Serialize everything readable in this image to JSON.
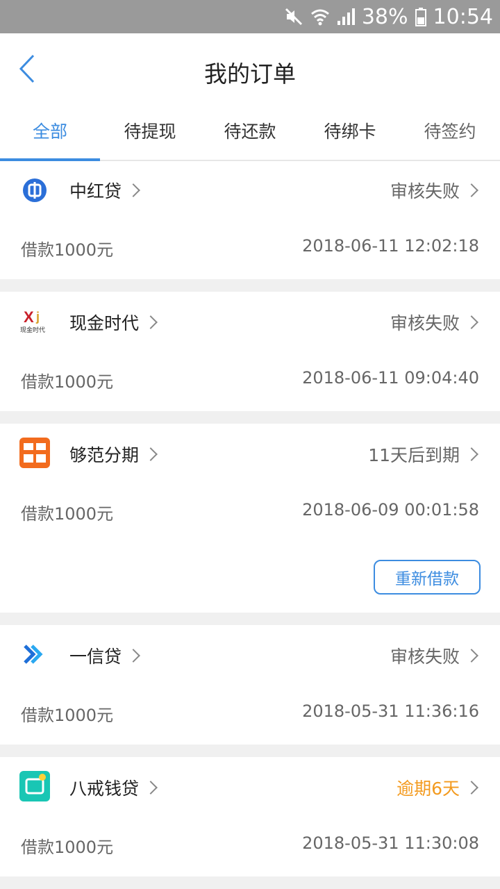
{
  "status_bar": {
    "battery": "38%",
    "time": "10:54"
  },
  "header": {
    "title": "我的订单"
  },
  "tabs": [
    {
      "label": "全部",
      "active": true
    },
    {
      "label": "待提现"
    },
    {
      "label": "待还款"
    },
    {
      "label": "待绑卡"
    },
    {
      "label": "待签约"
    }
  ],
  "orders": [
    {
      "name": "中红贷",
      "status": "审核失败",
      "amount": "借款1000元",
      "time": "2018-06-11 12:02:18"
    },
    {
      "name": "现金时代",
      "status": "审核失败",
      "amount": "借款1000元",
      "time": "2018-06-11 09:04:40",
      "logo_text": "现金时代"
    },
    {
      "name": "够范分期",
      "status": "11天后到期",
      "amount": "借款1000元",
      "time": "2018-06-09 00:01:58",
      "button": "重新借款"
    },
    {
      "name": "一信贷",
      "status": "审核失败",
      "amount": "借款1000元",
      "time": "2018-05-31 11:36:16"
    },
    {
      "name": "八戒钱贷",
      "status": "逾期6天",
      "status_color": "#f39a1e",
      "amount": "借款1000元",
      "time": "2018-05-31 11:30:08"
    }
  ],
  "colors": {
    "accent": "#3c8ce0",
    "warning": "#f39a1e"
  }
}
